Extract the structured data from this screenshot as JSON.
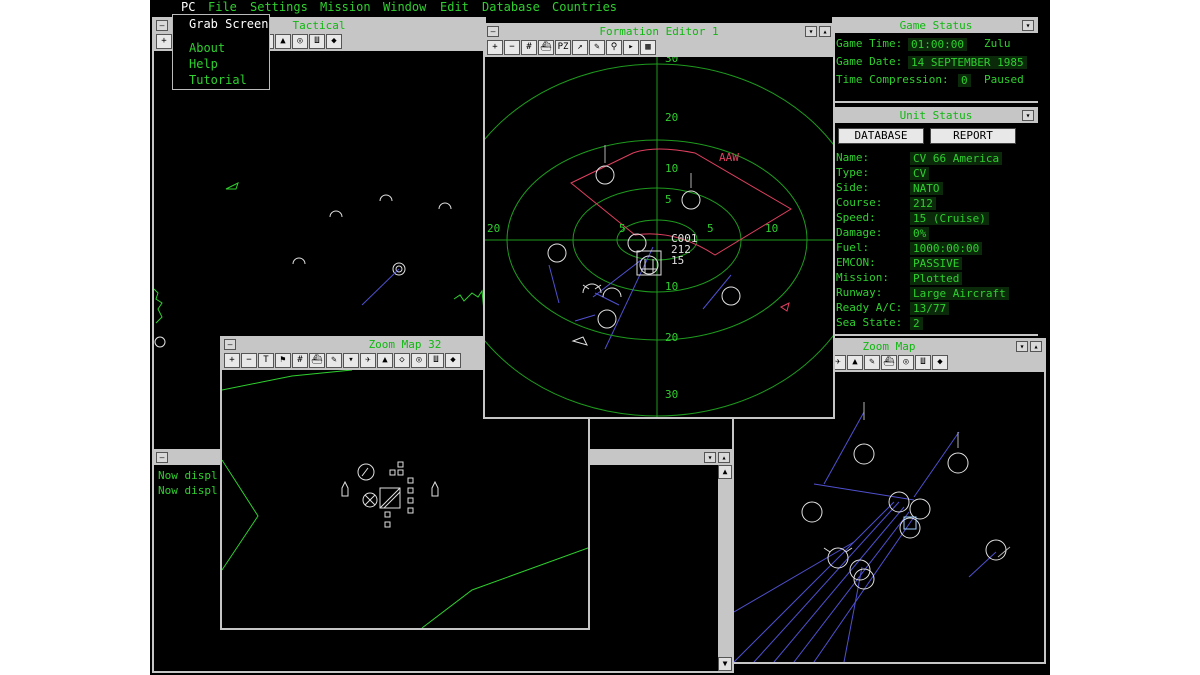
{
  "menubar": {
    "items": [
      "PC",
      "File",
      "Settings",
      "Mission",
      "Window",
      "Edit",
      "Database",
      "Countries"
    ],
    "open_menu": "PC",
    "dropdown": [
      "Grab Screen",
      "About",
      "Help",
      "Tutorial"
    ]
  },
  "tactical": {
    "title": "Tactical"
  },
  "formation": {
    "title": "Formation Editor 1",
    "sector_label": "AAW",
    "rings_y_labels": [
      "30",
      "20",
      "10",
      "5",
      "10",
      "20",
      "30"
    ],
    "rings_x_labels": [
      "20",
      "5",
      "5",
      "10"
    ],
    "unit_tag_lines": [
      "C001",
      "212",
      "15"
    ]
  },
  "game_status": {
    "title": "Game Status",
    "game_time_label": "Game Time:",
    "game_time_value": "01:00:00",
    "time_zone": "Zulu",
    "game_date_label": "Game Date:",
    "game_date_value": "14 SEPTEMBER 1985",
    "time_compression_label": "Time Compression:",
    "time_compression_value": "0",
    "paused_text": "Paused"
  },
  "unit_status": {
    "title": "Unit Status",
    "database_button": "DATABASE",
    "report_button": "REPORT",
    "fields": [
      {
        "label": "Name:",
        "value": "CV 66 America"
      },
      {
        "label": "Type:",
        "value": "CV"
      },
      {
        "label": "Side:",
        "value": "NATO"
      },
      {
        "label": "Course:",
        "value": "212"
      },
      {
        "label": "Speed:",
        "value": "15 (Cruise)"
      },
      {
        "label": "Damage:",
        "value": "0%"
      },
      {
        "label": "Fuel:",
        "value": "1000:00:00"
      },
      {
        "label": "EMCON:",
        "value": "PASSIVE"
      },
      {
        "label": "Mission:",
        "value": "Plotted"
      },
      {
        "label": "Runway:",
        "value": "Large Aircraft"
      },
      {
        "label": "Ready A/C:",
        "value": "13/77"
      },
      {
        "label": "Sea State:",
        "value": "2"
      }
    ]
  },
  "zoom32": {
    "title": "Zoom Map 32"
  },
  "zoom": {
    "title": "Zoom Map"
  },
  "message_log": {
    "lines": [
      "Now displ",
      "Now displ"
    ]
  },
  "colors": {
    "accent_green": "#2fd02f",
    "chrome_gray": "#c6c6c6",
    "sector_red": "#e04060",
    "ring_green": "#1e9a1e",
    "contact_blue": "#5050d0"
  }
}
